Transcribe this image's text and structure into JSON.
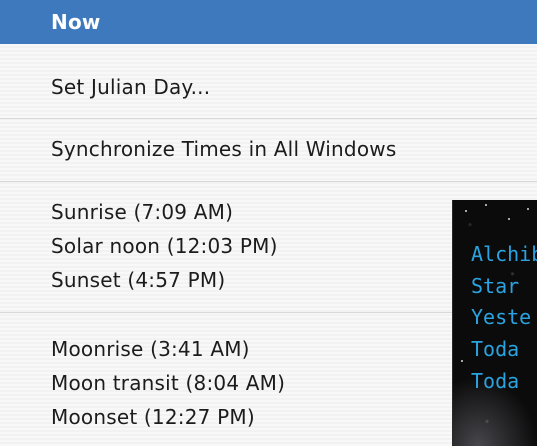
{
  "menu": {
    "items": [
      {
        "label": "Now"
      },
      {
        "label": "Set Julian Day..."
      },
      {
        "label": "Synchronize Times in All Windows"
      },
      {
        "label": "Sunrise (7:09 AM)"
      },
      {
        "label": "Solar noon (12:03 PM)"
      },
      {
        "label": "Sunset (4:57 PM)"
      },
      {
        "label": "Moonrise (3:41 AM)"
      },
      {
        "label": "Moon transit (8:04 AM)"
      },
      {
        "label": "Moonset (12:27 PM)"
      }
    ]
  },
  "background_window": {
    "lines": [
      "Alchib",
      "Star",
      "Yeste",
      "Toda",
      "Toda"
    ]
  },
  "colors": {
    "highlight": "#3f79bd",
    "sky_text": "#2aa4e0"
  }
}
